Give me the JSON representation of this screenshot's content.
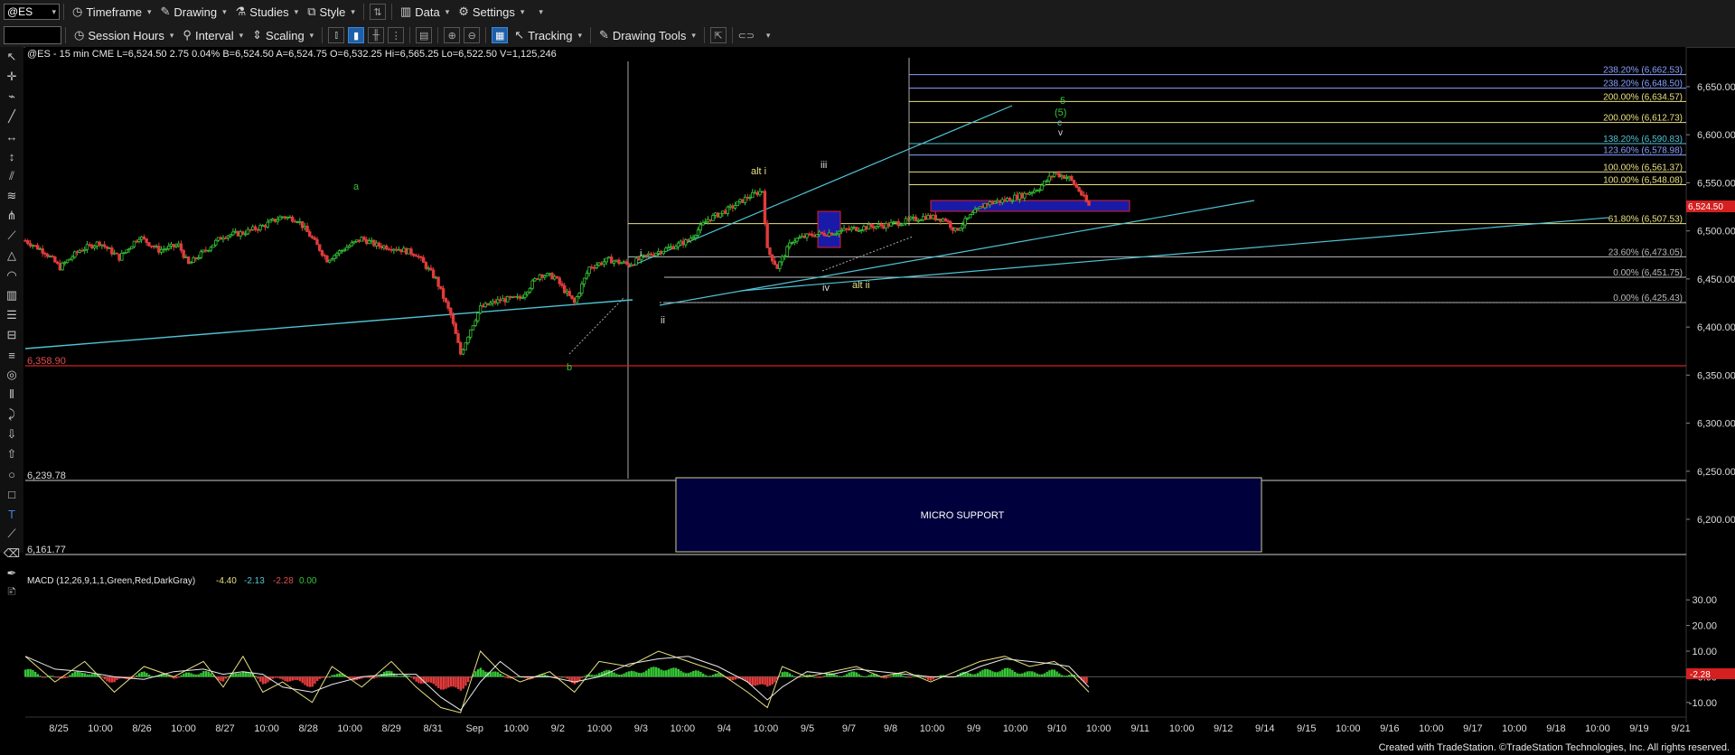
{
  "toolbar": {
    "symbol": "@ES",
    "timeframe": "Timeframe",
    "drawing": "Drawing",
    "studies": "Studies",
    "style": "Style",
    "data": "Data",
    "settings": "Settings",
    "session": "Session Hours",
    "interval": "Interval",
    "scaling": "Scaling",
    "tracking": "Tracking",
    "drawing_tools": "Drawing Tools"
  },
  "header": {
    "text": "@ES - 15 min  CME  L=6,524.50  2.75  0.04%  B=6,524.50  A=6,524.75  O=6,532.25  Hi=6,565.25  Lo=6,522.50  V=1,125,246"
  },
  "price_axis": [
    "6,650.00",
    "6,600.00",
    "6,550.00",
    "6,500.00",
    "6,450.00",
    "6,400.00",
    "6,350.00",
    "6,300.00",
    "6,250.00",
    "6,200.00"
  ],
  "last_price": "6,524.50",
  "levels": {
    "l1": "6,358.90",
    "l2": "6,239.78",
    "l3": "6,161.77"
  },
  "fib_labels": [
    "238.20% (6,662.53)",
    "238.20% (6,648.50)",
    "200.00% (6,634.57)",
    "200.00% (6,612.73)",
    "138.20% (6,590.83)",
    "123.60% (6,578.98)",
    "100.00% (6,561.37)",
    "100.00% (6,548.08)",
    "61.80% (6,507.53)",
    "23.60% (6,473.05)",
    "0.00% (6,451.75)",
    "0.00% (6,425.43)"
  ],
  "wave_labels": {
    "a": "a",
    "b": "b",
    "i": "i",
    "ii": "ii",
    "iii": "iii",
    "iv": "iv",
    "alt_i": "alt i",
    "alt_ii": "alt ii",
    "five": "5",
    "five_p": "(5)",
    "c": "c",
    "v": "v"
  },
  "micro_support": "MICRO SUPPORT",
  "macd": {
    "label": "MACD (12,26,9,1,1,Green,Red,DarkGray)",
    "v1": "-4.40",
    "v2": "-2.13",
    "v3": "-2.28",
    "v4": "0.00",
    "axis": [
      "30.00",
      "20.00",
      "10.00",
      "0.00",
      "-10.00"
    ],
    "last": "-2.28"
  },
  "time_axis": [
    "8/25",
    "10:00",
    "8/26",
    "10:00",
    "8/27",
    "10:00",
    "8/28",
    "10:00",
    "8/29",
    "8/31",
    "Sep",
    "10:00",
    "9/2",
    "10:00",
    "9/3",
    "10:00",
    "9/4",
    "10:00",
    "9/5",
    "9/7",
    "9/8",
    "10:00",
    "9/9",
    "10:00",
    "9/10",
    "10:00",
    "9/11",
    "10:00",
    "9/12",
    "9/14",
    "9/15",
    "10:00",
    "9/16",
    "10:00",
    "9/17",
    "10:00",
    "9/18",
    "10:00",
    "9/19",
    "9/21"
  ],
  "footer": "Created with TradeStation. ©TradeStation Technologies, Inc. All rights reserved.",
  "colors": {
    "bg": "#000000",
    "up": "#35c635",
    "down": "#e23b3b",
    "fib_yellow": "#e8e080",
    "fib_blue": "#8aa0ff",
    "trend": "#4fc4d6",
    "level_red": "#d42020",
    "support_box": "#00003c"
  },
  "chart_data": {
    "type": "candlestick",
    "symbol": "@ES",
    "interval": "15 min",
    "price_range": [
      6150,
      6675
    ],
    "price_path": [
      [
        0,
        6490
      ],
      [
        8,
        6478
      ],
      [
        14,
        6462
      ],
      [
        22,
        6480
      ],
      [
        30,
        6488
      ],
      [
        38,
        6472
      ],
      [
        46,
        6494
      ],
      [
        54,
        6480
      ],
      [
        62,
        6485
      ],
      [
        66,
        6465
      ],
      [
        72,
        6478
      ],
      [
        80,
        6495
      ],
      [
        88,
        6498
      ],
      [
        96,
        6505
      ],
      [
        104,
        6515
      ],
      [
        110,
        6512
      ],
      [
        116,
        6492
      ],
      [
        122,
        6470
      ],
      [
        128,
        6480
      ],
      [
        136,
        6492
      ],
      [
        142,
        6485
      ],
      [
        150,
        6482
      ],
      [
        158,
        6476
      ],
      [
        166,
        6450
      ],
      [
        172,
        6412
      ],
      [
        176,
        6372
      ],
      [
        180,
        6398
      ],
      [
        184,
        6420
      ],
      [
        192,
        6428
      ],
      [
        200,
        6430
      ],
      [
        208,
        6455
      ],
      [
        214,
        6452
      ],
      [
        218,
        6438
      ],
      [
        222,
        6425
      ],
      [
        228,
        6462
      ],
      [
        236,
        6470
      ],
      [
        244,
        6465
      ],
      [
        252,
        6475
      ],
      [
        260,
        6482
      ],
      [
        268,
        6490
      ],
      [
        276,
        6512
      ],
      [
        284,
        6522
      ],
      [
        292,
        6535
      ],
      [
        298,
        6542
      ],
      [
        300,
        6480
      ],
      [
        304,
        6462
      ],
      [
        310,
        6490
      ],
      [
        318,
        6496
      ],
      [
        326,
        6498
      ],
      [
        334,
        6502
      ],
      [
        340,
        6504
      ],
      [
        348,
        6506
      ],
      [
        356,
        6510
      ],
      [
        364,
        6515
      ],
      [
        372,
        6512
      ],
      [
        376,
        6500
      ],
      [
        382,
        6515
      ],
      [
        388,
        6528
      ],
      [
        396,
        6532
      ],
      [
        404,
        6538
      ],
      [
        410,
        6545
      ],
      [
        416,
        6560
      ],
      [
        422,
        6555
      ],
      [
        426,
        6542
      ],
      [
        430,
        6526
      ]
    ],
    "last": 6524.5,
    "open": 6532.25,
    "high": 6565.25,
    "low": 6522.5,
    "volume": 1125246,
    "macd_range": [
      -15,
      35
    ],
    "macd_path": [
      [
        0,
        8
      ],
      [
        12,
        -2
      ],
      [
        24,
        6
      ],
      [
        36,
        -6
      ],
      [
        48,
        4
      ],
      [
        60,
        0
      ],
      [
        72,
        6
      ],
      [
        80,
        -4
      ],
      [
        88,
        8
      ],
      [
        96,
        -6
      ],
      [
        104,
        -2
      ],
      [
        116,
        -10
      ],
      [
        124,
        4
      ],
      [
        136,
        -4
      ],
      [
        148,
        6
      ],
      [
        158,
        -4
      ],
      [
        168,
        -12
      ],
      [
        176,
        -14
      ],
      [
        184,
        10
      ],
      [
        192,
        2
      ],
      [
        200,
        -2
      ],
      [
        212,
        2
      ],
      [
        222,
        -6
      ],
      [
        232,
        6
      ],
      [
        244,
        4
      ],
      [
        256,
        10
      ],
      [
        268,
        6
      ],
      [
        280,
        2
      ],
      [
        292,
        -6
      ],
      [
        300,
        -12
      ],
      [
        306,
        4
      ],
      [
        316,
        0
      ],
      [
        326,
        2
      ],
      [
        336,
        4
      ],
      [
        346,
        0
      ],
      [
        356,
        2
      ],
      [
        366,
        -2
      ],
      [
        376,
        2
      ],
      [
        386,
        6
      ],
      [
        396,
        8
      ],
      [
        406,
        4
      ],
      [
        416,
        6
      ],
      [
        422,
        2
      ],
      [
        426,
        -2
      ],
      [
        430,
        -6
      ]
    ]
  }
}
